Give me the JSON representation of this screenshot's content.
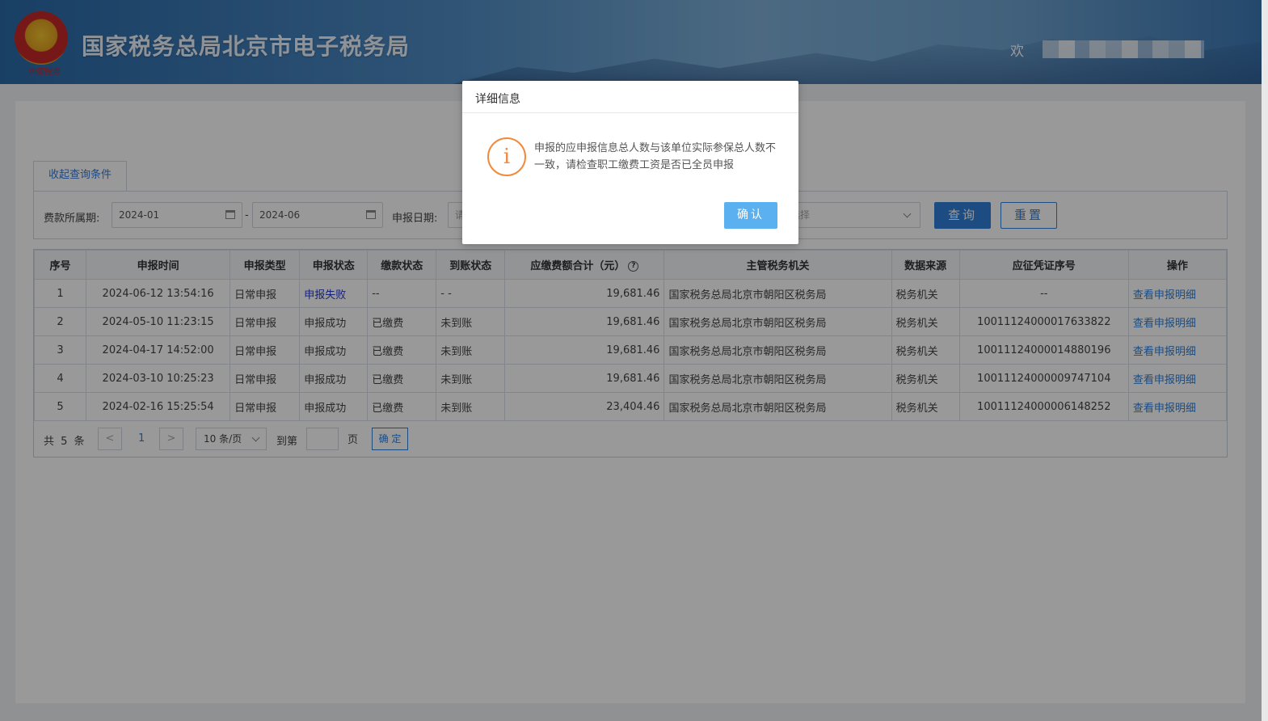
{
  "header": {
    "emblem_caption": "中国税务",
    "site_title": "国家税务总局北京市电子税务局",
    "welcome": "欢"
  },
  "query": {
    "tab_label": "收起查询条件",
    "period_label": "费款所属期:",
    "period_start": "2024-01",
    "period_sep": "-",
    "period_end": "2024-06",
    "declare_date_label": "申报日期:",
    "declare_date_placeholder": "请",
    "select_placeholder": "选择",
    "query_button": "查询",
    "reset_button": "重置"
  },
  "table": {
    "headers": [
      "序号",
      "申报时间",
      "申报类型",
      "申报状态",
      "缴款状态",
      "到账状态",
      "应缴费额合计（元）",
      "主管税务机关",
      "数据来源",
      "应征凭证序号",
      "操作"
    ],
    "help_icon": "?",
    "rows": [
      {
        "no": "1",
        "time": "2024-06-12 13:54:16",
        "type": "日常申报",
        "status": "申报失败",
        "pay": "--",
        "arrive": "- -",
        "amount": "19,681.46",
        "office": "国家税务总局北京市朝阳区税务局",
        "source": "税务机关",
        "voucher": "--",
        "action": "查看申报明细"
      },
      {
        "no": "2",
        "time": "2024-05-10 11:23:15",
        "type": "日常申报",
        "status": "申报成功",
        "pay": "已缴费",
        "arrive": "未到账",
        "amount": "19,681.46",
        "office": "国家税务总局北京市朝阳区税务局",
        "source": "税务机关",
        "voucher": "10011124000017633822",
        "action": "查看申报明细"
      },
      {
        "no": "3",
        "time": "2024-04-17 14:52:00",
        "type": "日常申报",
        "status": "申报成功",
        "pay": "已缴费",
        "arrive": "未到账",
        "amount": "19,681.46",
        "office": "国家税务总局北京市朝阳区税务局",
        "source": "税务机关",
        "voucher": "10011124000014880196",
        "action": "查看申报明细"
      },
      {
        "no": "4",
        "time": "2024-03-10 10:25:23",
        "type": "日常申报",
        "status": "申报成功",
        "pay": "已缴费",
        "arrive": "未到账",
        "amount": "19,681.46",
        "office": "国家税务总局北京市朝阳区税务局",
        "source": "税务机关",
        "voucher": "10011124000009747104",
        "action": "查看申报明细"
      },
      {
        "no": "5",
        "time": "2024-02-16 15:25:54",
        "type": "日常申报",
        "status": "申报成功",
        "pay": "已缴费",
        "arrive": "未到账",
        "amount": "23,404.46",
        "office": "国家税务总局北京市朝阳区税务局",
        "source": "税务机关",
        "voucher": "10011124000006148252",
        "action": "查看申报明细"
      }
    ]
  },
  "pager": {
    "total": "共 5 条",
    "prev": "<",
    "current_page": "1",
    "next": ">",
    "page_size": "10 条/页",
    "goto_label": "到第",
    "page_unit": "页",
    "confirm": "确 定"
  },
  "dialog": {
    "title": "详细信息",
    "icon_glyph": "i",
    "message": "申报的应申报信息总人数与该单位实际参保总人数不一致，请检查职工缴费工资是否已全员申报",
    "ok_button": "确认"
  },
  "colors": {
    "accent": "#2f7fd8",
    "warning": "#f08a3c",
    "fail_status": "#2636c6",
    "dialog_button": "#5bb0f0"
  }
}
